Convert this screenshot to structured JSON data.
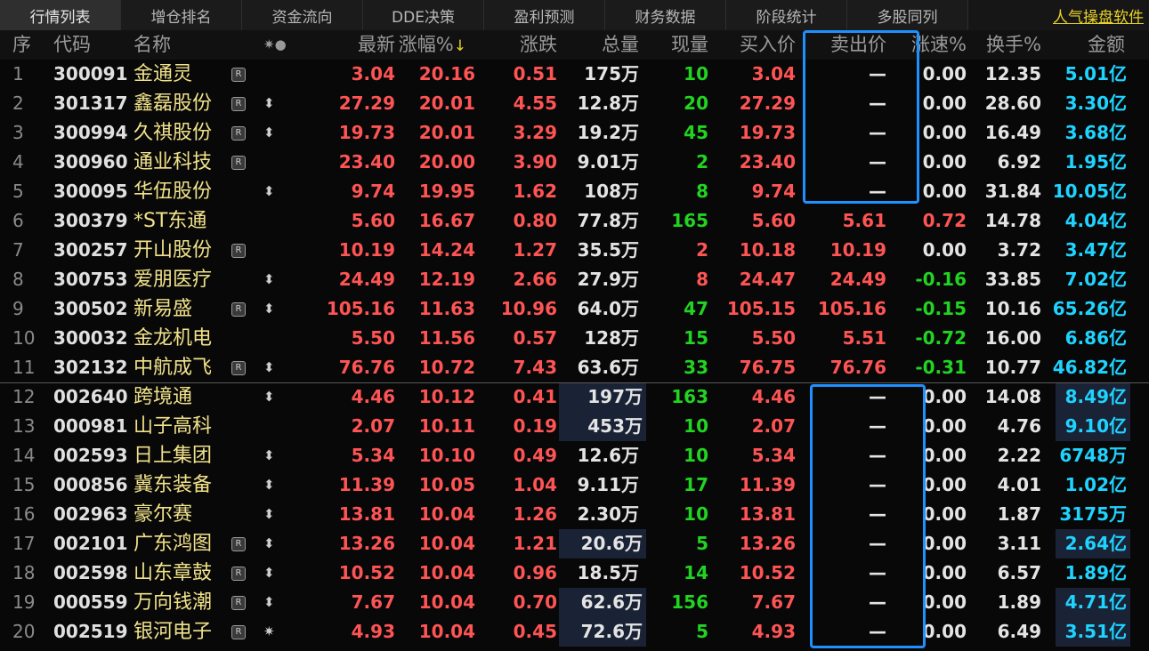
{
  "tabs": [
    "行情列表",
    "增仓排名",
    "资金流向",
    "DDE决策",
    "盈利预测",
    "财务数据",
    "阶段统计",
    "多股同列"
  ],
  "promo": "人气操盘软件",
  "columns": {
    "seq": "序",
    "code": "代码",
    "name": "名称",
    "flag": "✷●",
    "last": "最新",
    "chg_pct": "涨幅%",
    "sort_arrow": "↓",
    "chg": "涨跌",
    "volume": "总量",
    "cur_vol": "现量",
    "bid": "买入价",
    "ask": "卖出价",
    "speed": "涨速%",
    "turnover": "换手%",
    "amount": "金额"
  },
  "colors": {
    "up": "#ff5454",
    "down": "#22d422",
    "highlight": "#1e90ff",
    "name": "#f1e28a",
    "amount": "#1fd3ff"
  },
  "rows": [
    {
      "seq": "1",
      "code": "300091",
      "name": "金通灵",
      "r": true,
      "flag": "",
      "last": "3.04",
      "chg_pct": "20.16",
      "chg": "0.51",
      "volume": "175万",
      "cur_vol": "10",
      "bid": "3.04",
      "ask": "—",
      "speed": "0.00",
      "turnover": "12.35",
      "amount": "5.01亿",
      "vol_hl": false,
      "amt_hl": false,
      "cur_color": "green"
    },
    {
      "seq": "2",
      "code": "301317",
      "name": "鑫磊股份",
      "r": true,
      "flag": "⬍",
      "last": "27.29",
      "chg_pct": "20.01",
      "chg": "4.55",
      "volume": "12.8万",
      "cur_vol": "20",
      "bid": "27.29",
      "ask": "—",
      "speed": "0.00",
      "turnover": "28.60",
      "amount": "3.30亿",
      "vol_hl": false,
      "amt_hl": false,
      "cur_color": "green"
    },
    {
      "seq": "3",
      "code": "300994",
      "name": "久祺股份",
      "r": true,
      "flag": "⬍",
      "last": "19.73",
      "chg_pct": "20.01",
      "chg": "3.29",
      "volume": "19.2万",
      "cur_vol": "45",
      "bid": "19.73",
      "ask": "—",
      "speed": "0.00",
      "turnover": "16.49",
      "amount": "3.68亿",
      "vol_hl": false,
      "amt_hl": false,
      "cur_color": "green"
    },
    {
      "seq": "4",
      "code": "300960",
      "name": "通业科技",
      "r": true,
      "flag": "",
      "last": "23.40",
      "chg_pct": "20.00",
      "chg": "3.90",
      "volume": "9.01万",
      "cur_vol": "2",
      "bid": "23.40",
      "ask": "—",
      "speed": "0.00",
      "turnover": "6.92",
      "amount": "1.95亿",
      "vol_hl": false,
      "amt_hl": false,
      "cur_color": "green"
    },
    {
      "seq": "5",
      "code": "300095",
      "name": "华伍股份",
      "r": false,
      "flag": "⬍",
      "last": "9.74",
      "chg_pct": "19.95",
      "chg": "1.62",
      "volume": "108万",
      "cur_vol": "8",
      "bid": "9.74",
      "ask": "—",
      "speed": "0.00",
      "turnover": "31.84",
      "amount": "10.05亿",
      "vol_hl": false,
      "amt_hl": false,
      "cur_color": "green"
    },
    {
      "seq": "6",
      "code": "300379",
      "name": "*ST东通",
      "r": false,
      "flag": "",
      "last": "5.60",
      "chg_pct": "16.67",
      "chg": "0.80",
      "volume": "77.8万",
      "cur_vol": "165",
      "bid": "5.60",
      "ask": "5.61",
      "speed": "0.72",
      "turnover": "14.78",
      "amount": "4.04亿",
      "vol_hl": false,
      "amt_hl": false,
      "cur_color": "green",
      "speed_color": "red"
    },
    {
      "seq": "7",
      "code": "300257",
      "name": "开山股份",
      "r": true,
      "flag": "",
      "last": "10.19",
      "chg_pct": "14.24",
      "chg": "1.27",
      "volume": "35.5万",
      "cur_vol": "2",
      "bid": "10.18",
      "ask": "10.19",
      "speed": "0.00",
      "turnover": "3.72",
      "amount": "3.47亿",
      "vol_hl": false,
      "amt_hl": false,
      "cur_color": "red"
    },
    {
      "seq": "8",
      "code": "300753",
      "name": "爱朋医疗",
      "r": false,
      "flag": "⬍",
      "last": "24.49",
      "chg_pct": "12.19",
      "chg": "2.66",
      "volume": "27.9万",
      "cur_vol": "8",
      "bid": "24.47",
      "ask": "24.49",
      "speed": "-0.16",
      "turnover": "33.85",
      "amount": "7.02亿",
      "vol_hl": false,
      "amt_hl": false,
      "cur_color": "red",
      "speed_color": "green"
    },
    {
      "seq": "9",
      "code": "300502",
      "name": "新易盛",
      "r": true,
      "flag": "⬍",
      "last": "105.16",
      "chg_pct": "11.63",
      "chg": "10.96",
      "volume": "64.0万",
      "cur_vol": "47",
      "bid": "105.15",
      "ask": "105.16",
      "speed": "-0.15",
      "turnover": "10.16",
      "amount": "65.26亿",
      "vol_hl": false,
      "amt_hl": false,
      "cur_color": "green",
      "speed_color": "green"
    },
    {
      "seq": "10",
      "code": "300032",
      "name": "金龙机电",
      "r": false,
      "flag": "",
      "last": "5.50",
      "chg_pct": "11.56",
      "chg": "0.57",
      "volume": "128万",
      "cur_vol": "15",
      "bid": "5.50",
      "ask": "5.51",
      "speed": "-0.72",
      "turnover": "16.00",
      "amount": "6.86亿",
      "vol_hl": false,
      "amt_hl": false,
      "cur_color": "green",
      "speed_color": "green"
    },
    {
      "seq": "11",
      "code": "302132",
      "name": "中航成飞",
      "r": true,
      "flag": "⬍",
      "last": "76.76",
      "chg_pct": "10.72",
      "chg": "7.43",
      "volume": "63.6万",
      "cur_vol": "33",
      "bid": "76.75",
      "ask": "76.76",
      "speed": "-0.31",
      "turnover": "10.77",
      "amount": "46.82亿",
      "vol_hl": false,
      "amt_hl": false,
      "cur_color": "green",
      "speed_color": "green"
    },
    {
      "seq": "12",
      "code": "002640",
      "name": "跨境通",
      "r": false,
      "flag": "⬍",
      "last": "4.46",
      "chg_pct": "10.12",
      "chg": "0.41",
      "volume": "197万",
      "cur_vol": "163",
      "bid": "4.46",
      "ask": "—",
      "speed": "0.00",
      "turnover": "14.08",
      "amount": "8.49亿",
      "vol_hl": true,
      "amt_hl": true,
      "cur_color": "green"
    },
    {
      "seq": "13",
      "code": "000981",
      "name": "山子高科",
      "r": false,
      "flag": "",
      "last": "2.07",
      "chg_pct": "10.11",
      "chg": "0.19",
      "volume": "453万",
      "cur_vol": "10",
      "bid": "2.07",
      "ask": "—",
      "speed": "0.00",
      "turnover": "4.76",
      "amount": "9.10亿",
      "vol_hl": true,
      "amt_hl": true,
      "cur_color": "green"
    },
    {
      "seq": "14",
      "code": "002593",
      "name": "日上集团",
      "r": false,
      "flag": "⬍",
      "last": "5.34",
      "chg_pct": "10.10",
      "chg": "0.49",
      "volume": "12.6万",
      "cur_vol": "10",
      "bid": "5.34",
      "ask": "—",
      "speed": "0.00",
      "turnover": "2.22",
      "amount": "6748万",
      "vol_hl": false,
      "amt_hl": false,
      "cur_color": "green"
    },
    {
      "seq": "15",
      "code": "000856",
      "name": "冀东装备",
      "r": false,
      "flag": "⬍",
      "last": "11.39",
      "chg_pct": "10.05",
      "chg": "1.04",
      "volume": "9.11万",
      "cur_vol": "17",
      "bid": "11.39",
      "ask": "—",
      "speed": "0.00",
      "turnover": "4.01",
      "amount": "1.02亿",
      "vol_hl": false,
      "amt_hl": false,
      "cur_color": "green"
    },
    {
      "seq": "16",
      "code": "002963",
      "name": "豪尔赛",
      "r": false,
      "flag": "⬍",
      "last": "13.81",
      "chg_pct": "10.04",
      "chg": "1.26",
      "volume": "2.30万",
      "cur_vol": "10",
      "bid": "13.81",
      "ask": "—",
      "speed": "0.00",
      "turnover": "1.87",
      "amount": "3175万",
      "vol_hl": false,
      "amt_hl": false,
      "cur_color": "green"
    },
    {
      "seq": "17",
      "code": "002101",
      "name": "广东鸿图",
      "r": true,
      "flag": "⬍",
      "last": "13.26",
      "chg_pct": "10.04",
      "chg": "1.21",
      "volume": "20.6万",
      "cur_vol": "5",
      "bid": "13.26",
      "ask": "—",
      "speed": "0.00",
      "turnover": "3.11",
      "amount": "2.64亿",
      "vol_hl": true,
      "amt_hl": true,
      "cur_color": "green"
    },
    {
      "seq": "18",
      "code": "002598",
      "name": "山东章鼓",
      "r": true,
      "flag": "⬍",
      "last": "10.52",
      "chg_pct": "10.04",
      "chg": "0.96",
      "volume": "18.5万",
      "cur_vol": "14",
      "bid": "10.52",
      "ask": "—",
      "speed": "0.00",
      "turnover": "6.57",
      "amount": "1.89亿",
      "vol_hl": false,
      "amt_hl": false,
      "cur_color": "green"
    },
    {
      "seq": "19",
      "code": "000559",
      "name": "万向钱潮",
      "r": true,
      "flag": "⬍",
      "last": "7.67",
      "chg_pct": "10.04",
      "chg": "0.70",
      "volume": "62.6万",
      "cur_vol": "156",
      "bid": "7.67",
      "ask": "—",
      "speed": "0.00",
      "turnover": "1.89",
      "amount": "4.71亿",
      "vol_hl": true,
      "amt_hl": true,
      "cur_color": "green"
    },
    {
      "seq": "20",
      "code": "002519",
      "name": "银河电子",
      "r": true,
      "flag": "✷",
      "last": "4.93",
      "chg_pct": "10.04",
      "chg": "0.45",
      "volume": "72.6万",
      "cur_vol": "5",
      "bid": "4.93",
      "ask": "—",
      "speed": "0.00",
      "turnover": "6.49",
      "amount": "3.51亿",
      "vol_hl": true,
      "amt_hl": true,
      "cur_color": "green"
    }
  ]
}
